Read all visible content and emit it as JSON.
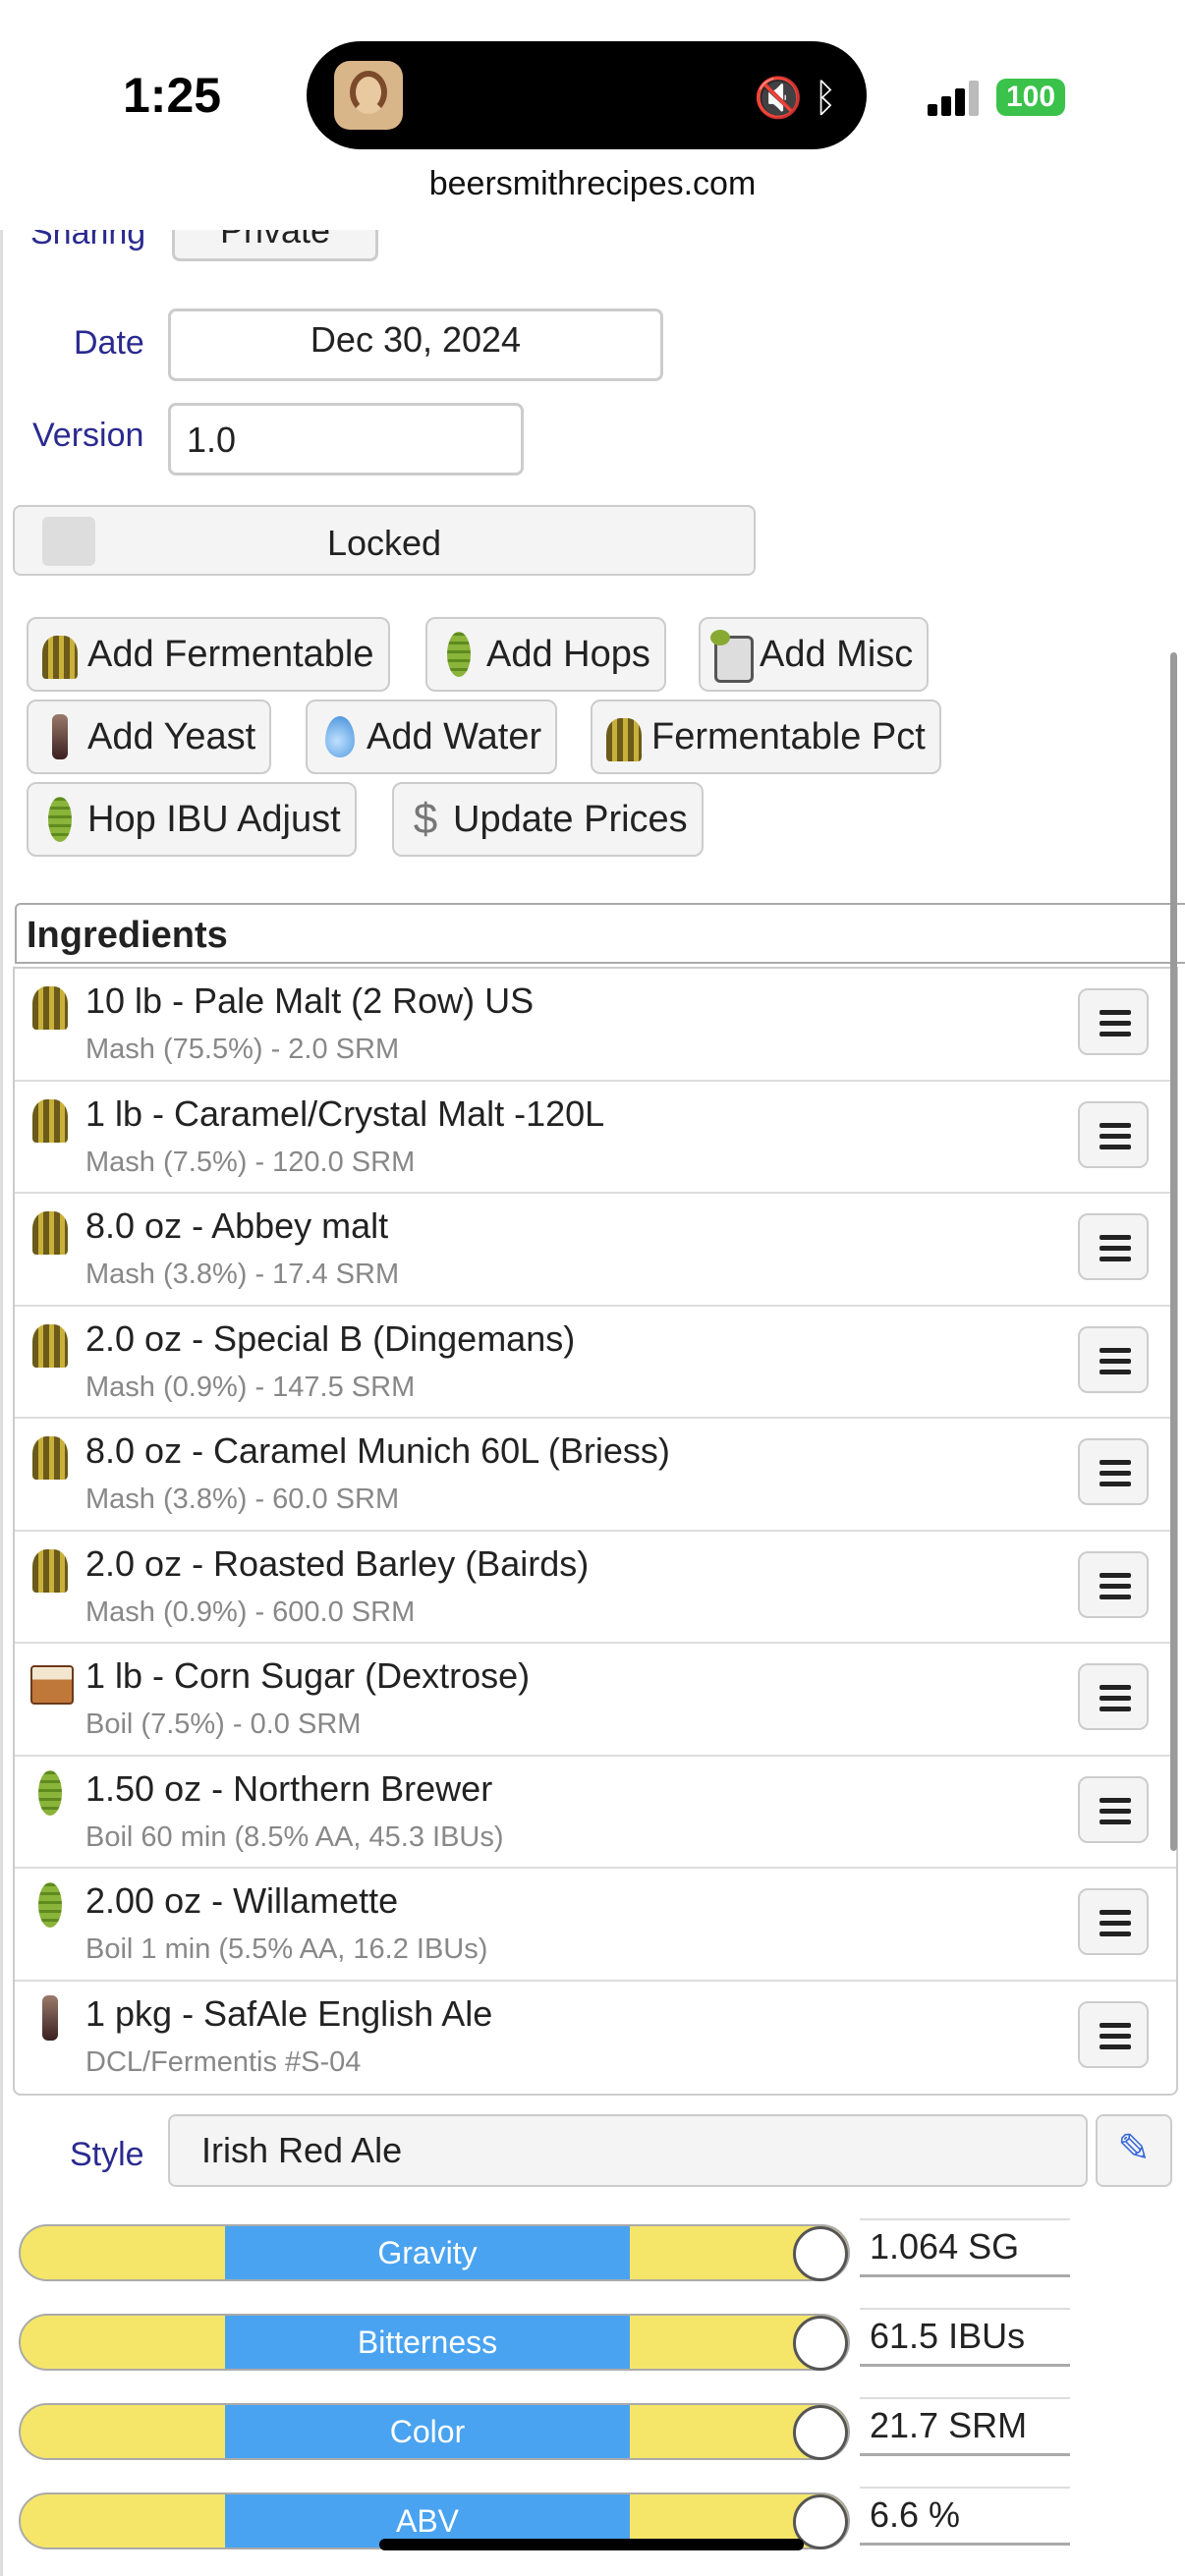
{
  "status": {
    "time": "1:25",
    "battery": "100"
  },
  "browser": {
    "url": "beersmithrecipes.com"
  },
  "form": {
    "sharing_label": "Sharing",
    "sharing_value": "Private",
    "date_label": "Date",
    "date_value": "Dec 30, 2024",
    "version_label": "Version",
    "version_value": "1.0",
    "locked_label": "Locked"
  },
  "actions": {
    "add_fermentable": "Add Fermentable",
    "add_hops": "Add Hops",
    "add_misc": "Add Misc",
    "add_yeast": "Add Yeast",
    "add_water": "Add Water",
    "fermentable_pct": "Fermentable Pct",
    "hop_ibu_adjust": "Hop IBU Adjust",
    "update_prices": "Update Prices"
  },
  "ingredients": {
    "header": "Ingredients",
    "items": [
      {
        "icon": "grain-icon",
        "name": "10 lb - Pale Malt (2 Row) US",
        "detail": "Mash (75.5%) - 2.0 SRM"
      },
      {
        "icon": "grain-icon",
        "name": "1 lb - Caramel/Crystal Malt -120L",
        "detail": "Mash (7.5%) - 120.0 SRM"
      },
      {
        "icon": "grain-icon",
        "name": "8.0 oz - Abbey malt",
        "detail": "Mash (3.8%) - 17.4 SRM"
      },
      {
        "icon": "grain-icon",
        "name": "2.0 oz - Special B (Dingemans)",
        "detail": "Mash (0.9%) - 147.5 SRM"
      },
      {
        "icon": "grain-icon",
        "name": "8.0 oz - Caramel Munich 60L (Briess)",
        "detail": "Mash (3.8%) - 60.0 SRM"
      },
      {
        "icon": "grain-icon",
        "name": "2.0 oz - Roasted Barley (Bairds)",
        "detail": "Mash (0.9%) - 600.0 SRM"
      },
      {
        "icon": "sugar-icon",
        "name": "1 lb - Corn Sugar (Dextrose)",
        "detail": "Boil (7.5%) - 0.0 SRM"
      },
      {
        "icon": "hop-icon",
        "name": "1.50 oz - Northern Brewer",
        "detail": "Boil 60 min (8.5% AA, 45.3 IBUs)"
      },
      {
        "icon": "hop-icon",
        "name": "2.00 oz - Willamette",
        "detail": "Boil 1 min (5.5% AA, 16.2 IBUs)"
      },
      {
        "icon": "yeast-icon",
        "name": "1 pkg - SafAle English Ale",
        "detail": "DCL/Fermentis #S-04"
      }
    ]
  },
  "style": {
    "label": "Style",
    "value": "Irish Red Ale"
  },
  "stats": [
    {
      "label": "Gravity",
      "value": "1.064 SG"
    },
    {
      "label": "Bitterness",
      "value": "61.5 IBUs"
    },
    {
      "label": "Color",
      "value": "21.7 SRM"
    },
    {
      "label": "ABV",
      "value": "6.6 %"
    }
  ]
}
